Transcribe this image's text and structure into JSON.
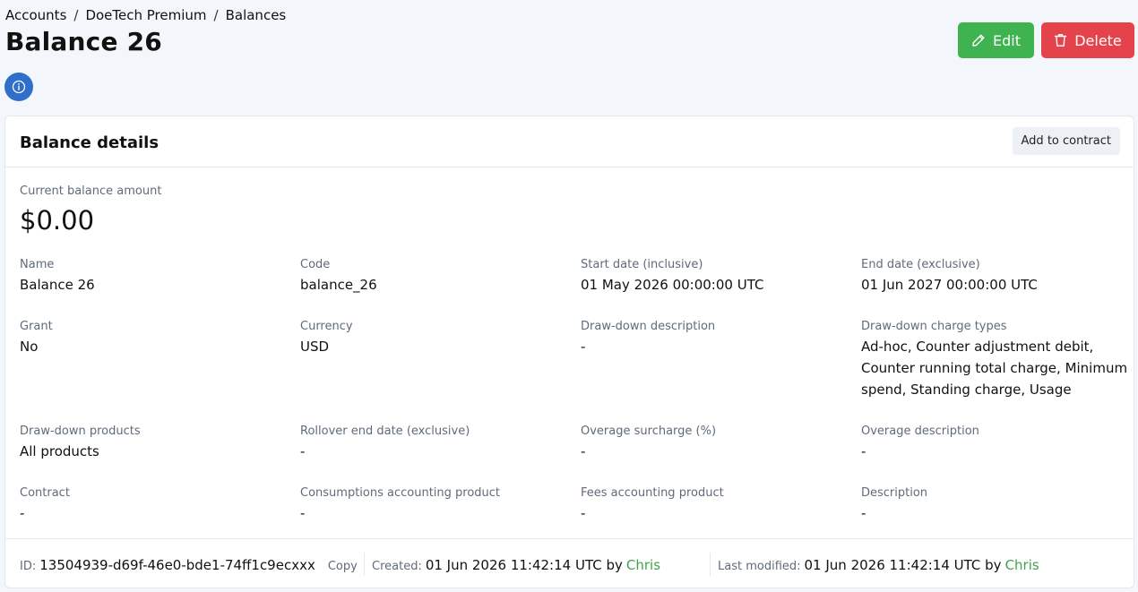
{
  "breadcrumb": {
    "items": [
      "Accounts",
      "DoeTech Premium",
      "Balances"
    ],
    "separator": "/"
  },
  "page": {
    "title": "Balance 26"
  },
  "toolbar": {
    "edit_label": "Edit",
    "delete_label": "Delete"
  },
  "colors": {
    "edit": "#3fb34f",
    "delete": "#e5434b",
    "info": "#2f6fc9",
    "link": "#3fa34d"
  },
  "card": {
    "title": "Balance details",
    "add_to_contract_label": "Add to contract",
    "current_balance_label": "Current balance amount",
    "current_balance_value": "$0.00",
    "fields": [
      {
        "label": "Name",
        "value": "Balance 26"
      },
      {
        "label": "Code",
        "value": "balance_26"
      },
      {
        "label": "Start date (inclusive)",
        "value": "01 May 2026 00:00:00 UTC"
      },
      {
        "label": "End date (exclusive)",
        "value": "01 Jun 2027 00:00:00 UTC"
      },
      {
        "label": "Grant",
        "value": "No"
      },
      {
        "label": "Currency",
        "value": "USD"
      },
      {
        "label": "Draw-down description",
        "value": "-"
      },
      {
        "label": "Draw-down charge types",
        "value": "Ad-hoc, Counter adjustment debit, Counter running total charge, Minimum spend, Standing charge, Usage"
      },
      {
        "label": "Draw-down products",
        "value": "All products"
      },
      {
        "label": "Rollover end date (exclusive)",
        "value": "-"
      },
      {
        "label": "Overage surcharge (%)",
        "value": "-"
      },
      {
        "label": "Overage description",
        "value": "-"
      },
      {
        "label": "Contract",
        "value": "-"
      },
      {
        "label": "Consumptions accounting product",
        "value": "-"
      },
      {
        "label": "Fees accounting product",
        "value": "-"
      },
      {
        "label": "Description",
        "value": "-"
      }
    ]
  },
  "footer": {
    "id_label": "ID:",
    "id_value": "13504939-d69f-46e0-bde1-74ff1c9ecxxx",
    "copy_label": "Copy",
    "created_label": "Created:",
    "created_value": "01 Jun 2026 11:42:14 UTC by",
    "created_by": "Chris",
    "modified_label": "Last modified:",
    "modified_value": "01 Jun 2026 11:42:14 UTC by",
    "modified_by": "Chris"
  }
}
